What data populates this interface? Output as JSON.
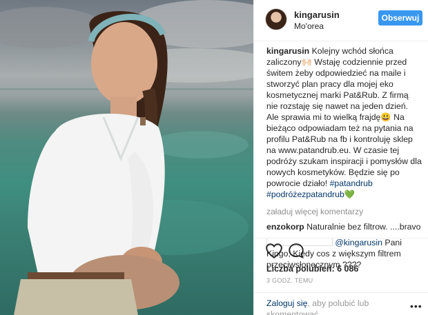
{
  "post": {
    "username": "kingarusin",
    "location": "Mo'orea",
    "follow_label": "Obserwuj",
    "caption_user": "kingarusin",
    "caption_text": "Kolejny wchód słońca zaliczony🙌🏻 Wstaję codziennie przed świtem żeby odpowiedzieć na maile i stworzyć plan pracy dla mojej eko kosmetycznej marki Pat&Rub. Z firmą nie rozstaję się nawet na jeden dzień. Ale sprawia mi to wielką frajdę😃 Na bieżąco odpowiadam też na pytania na profilu Pat&Rub na fb i kontroluję sklep na www.patandrub.eu. W czasie tej podróży szukam inspiracji i pomysłów dla nowych kosmetyków. Będzie się po powrocie działo! ",
    "hashtag1": "#patandrub",
    "hashtag2": "#podróżezpatandrub",
    "heart_emoji": "💚",
    "load_more": "załaduj więcej komentarzy",
    "comments": [
      {
        "user": "enzokorp",
        "text": "Naturalnie bez filtrow. ....bravo"
      },
      {
        "mention": "@kingarusin",
        "text": " Pani Kingo, Kiedy cos z większym filtrem przeciwsłonecznym ????"
      }
    ],
    "likes": "Liczba polubień: 6 086",
    "time": "3 GODZ. TEMU",
    "login_link": "Zaloguj się",
    "login_text": ", aby polubić lub skomentować.",
    "more_dots": "•••"
  },
  "colors": {
    "follow_bg": "#3897f0",
    "link": "#003569",
    "muted": "#8e8e8e"
  },
  "icons": {
    "like": "heart-outline-icon",
    "comment": "speech-bubble-icon",
    "more": "more-options-icon"
  }
}
